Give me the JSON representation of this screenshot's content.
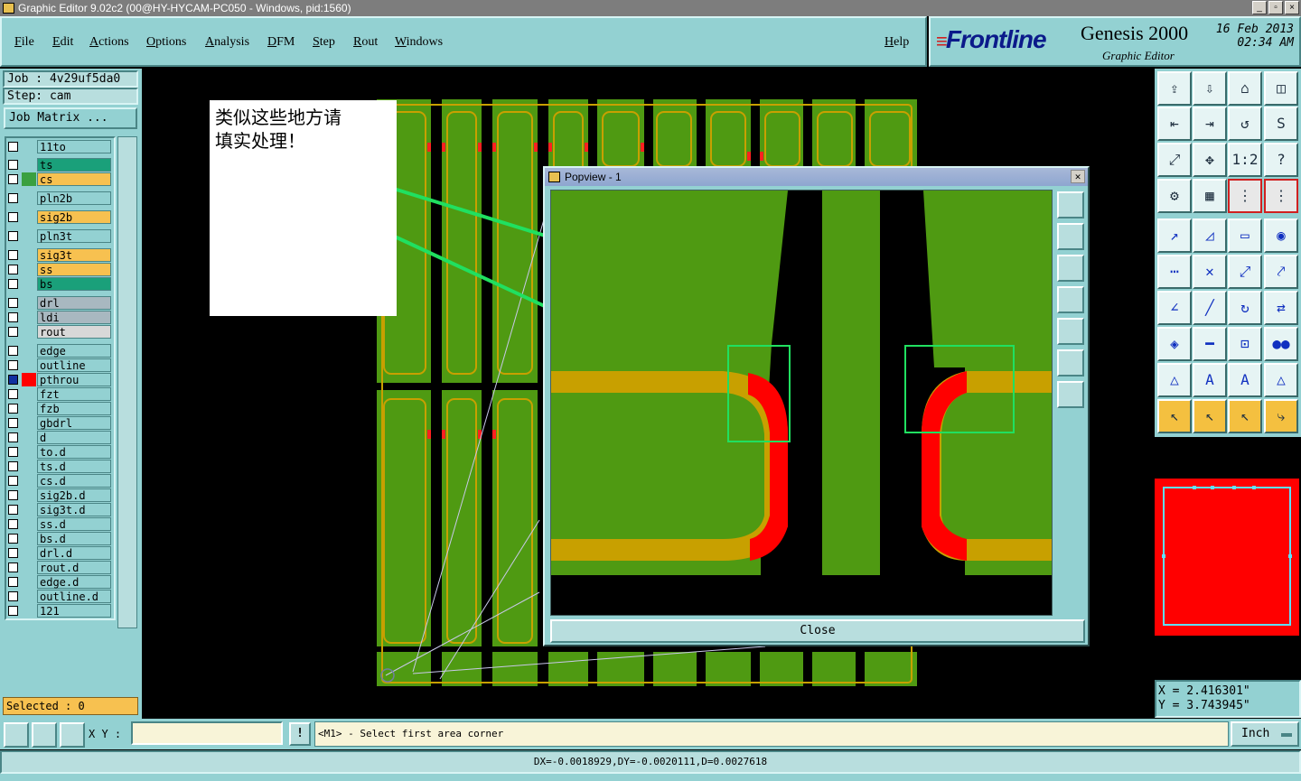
{
  "window": {
    "title": "Graphic Editor 9.02c2 (00@HY-HYCAM-PC050 - Windows, pid:1560)"
  },
  "menu": {
    "file": "File",
    "edit": "Edit",
    "actions": "Actions",
    "options": "Options",
    "analysis": "Analysis",
    "dfm": "DFM",
    "step": "Step",
    "rout": "Rout",
    "windows": "Windows",
    "help": "Help"
  },
  "brand": {
    "logo": "Frontline",
    "product": "Genesis 2000",
    "subtitle": "Graphic Editor",
    "date": "16 Feb 2013",
    "time": "02:34 AM"
  },
  "job": {
    "job_label": "Job : 4v29uf5da0",
    "step_label": "Step: cam",
    "matrix_button": "Job Matrix ..."
  },
  "layers": [
    {
      "name": "11to",
      "color": "#93d1d2",
      "swatch": ""
    },
    {
      "name": "ts",
      "color": "#1aa07a",
      "swatch": ""
    },
    {
      "name": "cs",
      "color": "#f7c150",
      "swatch": "#3aa040"
    },
    {
      "name": "pln2b",
      "color": "#93d1d2",
      "swatch": ""
    },
    {
      "name": "sig2b",
      "color": "#f7c150",
      "swatch": ""
    },
    {
      "name": "pln3t",
      "color": "#93d1d2",
      "swatch": ""
    },
    {
      "name": "sig3t",
      "color": "#f7c150",
      "swatch": ""
    },
    {
      "name": "ss",
      "color": "#f7c150",
      "swatch": ""
    },
    {
      "name": "bs",
      "color": "#1aa07a",
      "swatch": ""
    },
    {
      "name": "drl",
      "color": "#a8b8c0",
      "swatch": ""
    },
    {
      "name": "ldi",
      "color": "#a8b8c0",
      "swatch": ""
    },
    {
      "name": "rout",
      "color": "#d8d8d8",
      "swatch": ""
    },
    {
      "name": "edge",
      "color": "#93d1d2",
      "swatch": ""
    },
    {
      "name": "outline",
      "color": "#93d1d2",
      "swatch": ""
    },
    {
      "name": "pthrou",
      "color": "#93d1d2",
      "swatch": "#ff0000"
    },
    {
      "name": "fzt",
      "color": "#93d1d2",
      "swatch": ""
    },
    {
      "name": "fzb",
      "color": "#93d1d2",
      "swatch": ""
    },
    {
      "name": "gbdrl",
      "color": "#93d1d2",
      "swatch": ""
    },
    {
      "name": "d",
      "color": "#93d1d2",
      "swatch": ""
    },
    {
      "name": "to.d",
      "color": "#93d1d2",
      "swatch": ""
    },
    {
      "name": "ts.d",
      "color": "#93d1d2",
      "swatch": ""
    },
    {
      "name": "cs.d",
      "color": "#93d1d2",
      "swatch": ""
    },
    {
      "name": "sig2b.d",
      "color": "#93d1d2",
      "swatch": ""
    },
    {
      "name": "sig3t.d",
      "color": "#93d1d2",
      "swatch": ""
    },
    {
      "name": "ss.d",
      "color": "#93d1d2",
      "swatch": ""
    },
    {
      "name": "bs.d",
      "color": "#93d1d2",
      "swatch": ""
    },
    {
      "name": "drl.d",
      "color": "#93d1d2",
      "swatch": ""
    },
    {
      "name": "rout.d",
      "color": "#93d1d2",
      "swatch": ""
    },
    {
      "name": "edge.d",
      "color": "#93d1d2",
      "swatch": ""
    },
    {
      "name": "outline.d",
      "color": "#93d1d2",
      "swatch": ""
    },
    {
      "name": "121",
      "color": "#93d1d2",
      "swatch": ""
    }
  ],
  "selected": "Selected : 0",
  "annotation": {
    "line1": "类似这些地方请",
    "line2": "填实处理！"
  },
  "popview": {
    "title": "Popview - 1",
    "close_button": "Close"
  },
  "coords": {
    "x": "X = 2.416301\"",
    "y": "Y = 3.743945\""
  },
  "bottom": {
    "xy_label": "X Y :",
    "xy_value": "",
    "prompt": "<M1> - Select first area corner",
    "unit": "Inch",
    "status": "DX=-0.0018929,DY=-0.0020111,D=0.0027618"
  },
  "colors": {
    "panel": "#93d1d2",
    "board": "#4f9a12",
    "copper": "#c8a000",
    "highlight": "#ff0000",
    "annot_line": "#20e060"
  }
}
